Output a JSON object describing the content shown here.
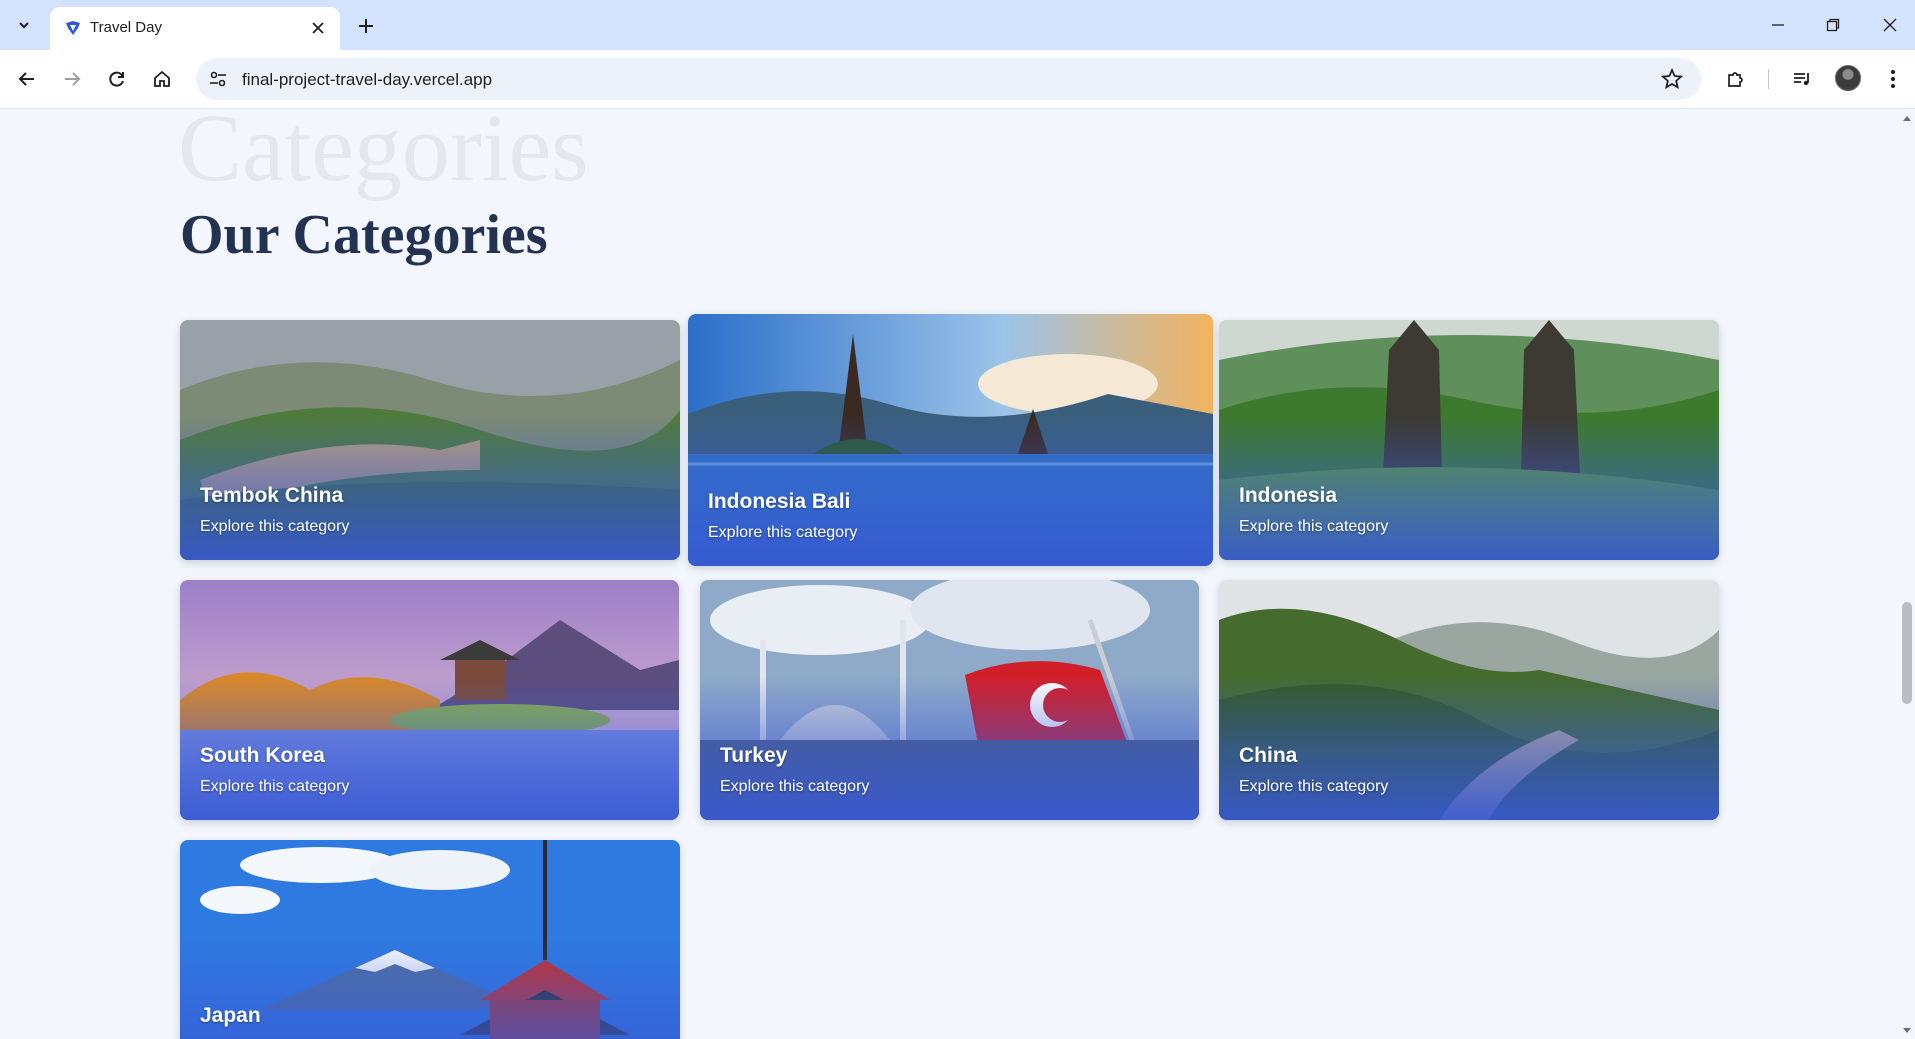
{
  "browser": {
    "tab_title": "Travel Day",
    "url": "final-project-travel-day.vercel.app",
    "icons": [
      "tab-search-icon",
      "favicon-icon",
      "close-icon",
      "plus-icon",
      "minimize-icon",
      "restore-icon",
      "window-close-icon",
      "back-icon",
      "forward-icon",
      "reload-icon",
      "home-icon",
      "site-settings-icon",
      "star-icon",
      "extensions-icon",
      "media-control-icon",
      "avatar",
      "more-icon"
    ]
  },
  "page": {
    "watermark": "Categories",
    "heading": "Our Categories",
    "cards": [
      {
        "name": "Tembok China",
        "subtitle": "Explore this category"
      },
      {
        "name": "Indonesia Bali",
        "subtitle": "Explore this category"
      },
      {
        "name": "Indonesia",
        "subtitle": "Explore this category"
      },
      {
        "name": "South Korea",
        "subtitle": "Explore this category"
      },
      {
        "name": "Turkey",
        "subtitle": "Explore this category"
      },
      {
        "name": "China",
        "subtitle": "Explore this category"
      },
      {
        "name": "Japan",
        "subtitle": ""
      }
    ]
  },
  "colors": {
    "page_bg": "#f3f6fc",
    "heading": "#243251",
    "card_overlay": "#3a5ad8",
    "tabstrip": "#d3e3fd"
  }
}
